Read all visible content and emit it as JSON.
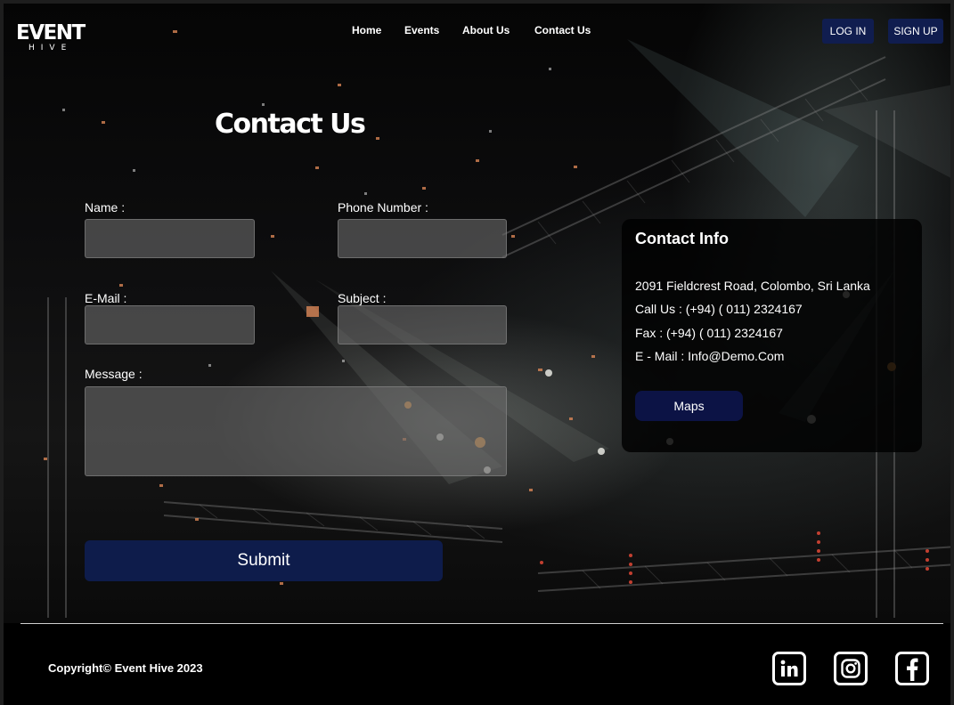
{
  "logo": {
    "main": "EVENT",
    "sub": "HIVE"
  },
  "nav": {
    "items": [
      {
        "label": "Home"
      },
      {
        "label": "Events"
      },
      {
        "label": "About Us"
      },
      {
        "label": "Contact Us"
      }
    ],
    "login_label": "LOG IN",
    "signup_label": "SIGN UP"
  },
  "page_title": "Contact Us",
  "form": {
    "name_label": "Name :",
    "name_value": "",
    "phone_label": "Phone Number :",
    "phone_value": "",
    "email_label": "E-Mail :",
    "email_value": "",
    "subject_label": "Subject :",
    "subject_value": "",
    "message_label": "Message :",
    "message_value": "",
    "submit_label": "Submit"
  },
  "contact_info": {
    "heading": "Contact Info",
    "address": "2091 Fieldcrest Road, Colombo, Sri Lanka",
    "call": "Call Us : (+94) ( 011) 2324167",
    "fax": "Fax : (+94) ( 011) 2324167",
    "email": "E - Mail  : Info@Demo.Com",
    "maps_label": "Maps"
  },
  "footer": {
    "copyright": "Copyright© Event Hive 2023",
    "social": [
      {
        "icon": "linkedin-icon"
      },
      {
        "icon": "instagram-icon"
      },
      {
        "icon": "facebook-icon"
      }
    ]
  },
  "colors": {
    "accent_button": "#101d4f",
    "submit_button": "#0e1c4b",
    "maps_button": "#0c1345",
    "background": "#000000"
  }
}
